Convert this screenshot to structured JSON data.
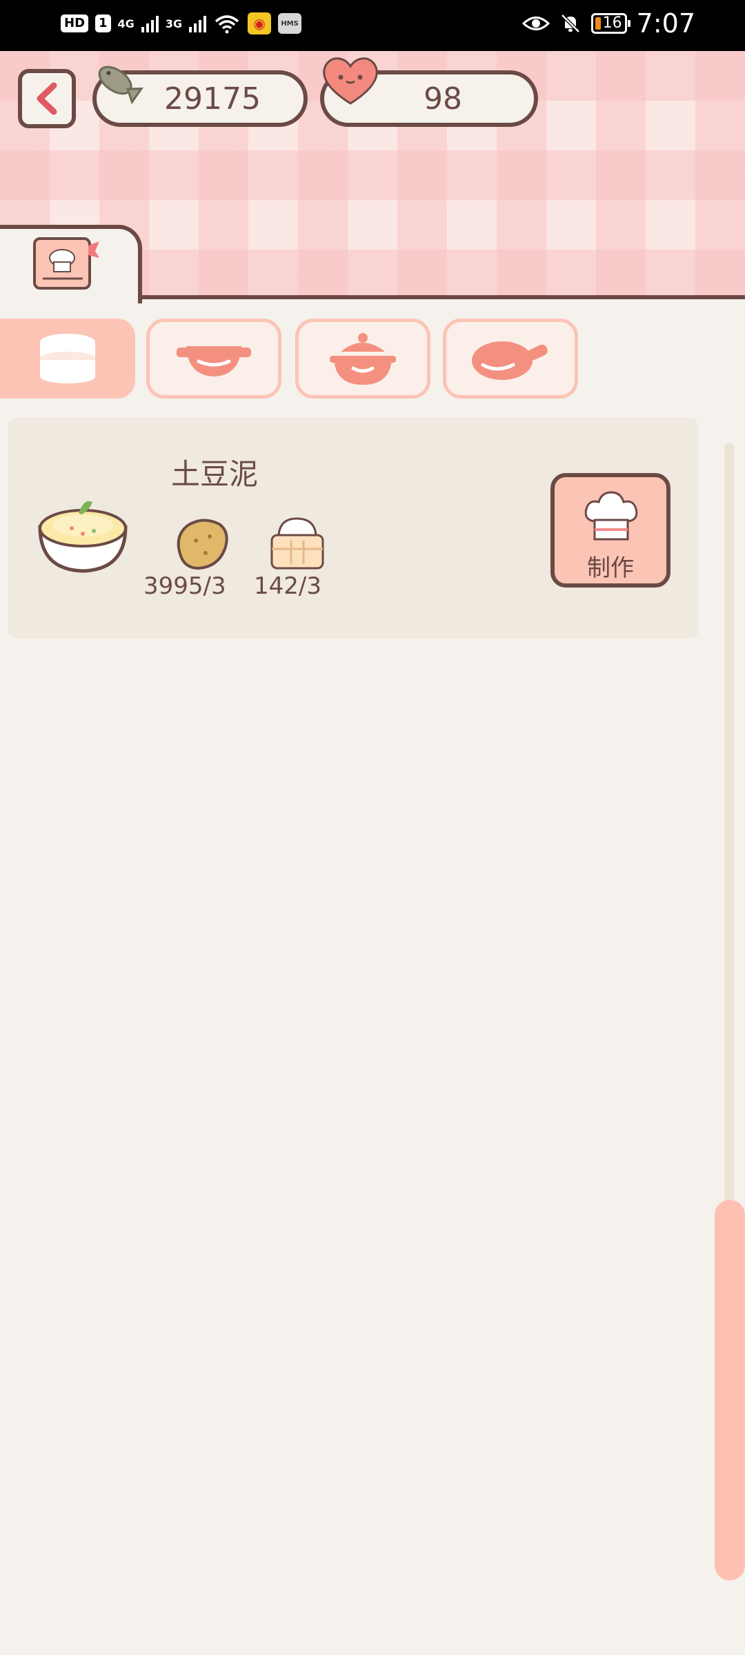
{
  "status_bar": {
    "hd_badge": "HD",
    "sim_badge": "1",
    "net_1": "4G",
    "net_2": "3G",
    "hms_label": "HMS",
    "battery_level": "16",
    "time": "7:07"
  },
  "currencies": {
    "fish": "29175",
    "hearts": "98"
  },
  "categories": [
    {
      "icon": "steamer-icon",
      "active": true
    },
    {
      "icon": "wok-icon",
      "active": false
    },
    {
      "icon": "pot-icon",
      "active": false
    },
    {
      "icon": "frying-pan-icon",
      "active": false
    }
  ],
  "recipe": {
    "name": "土豆泥",
    "ingredients": [
      {
        "icon": "potato-icon",
        "count": "3995/3"
      },
      {
        "icon": "rice-steamer-icon",
        "count": "142/3"
      }
    ],
    "make_label": "制作"
  },
  "colors": {
    "outline": "#6b4a45",
    "accent_pink": "#fcc4b5",
    "back_arrow": "#e05a63",
    "background": "#f5f2ed"
  }
}
